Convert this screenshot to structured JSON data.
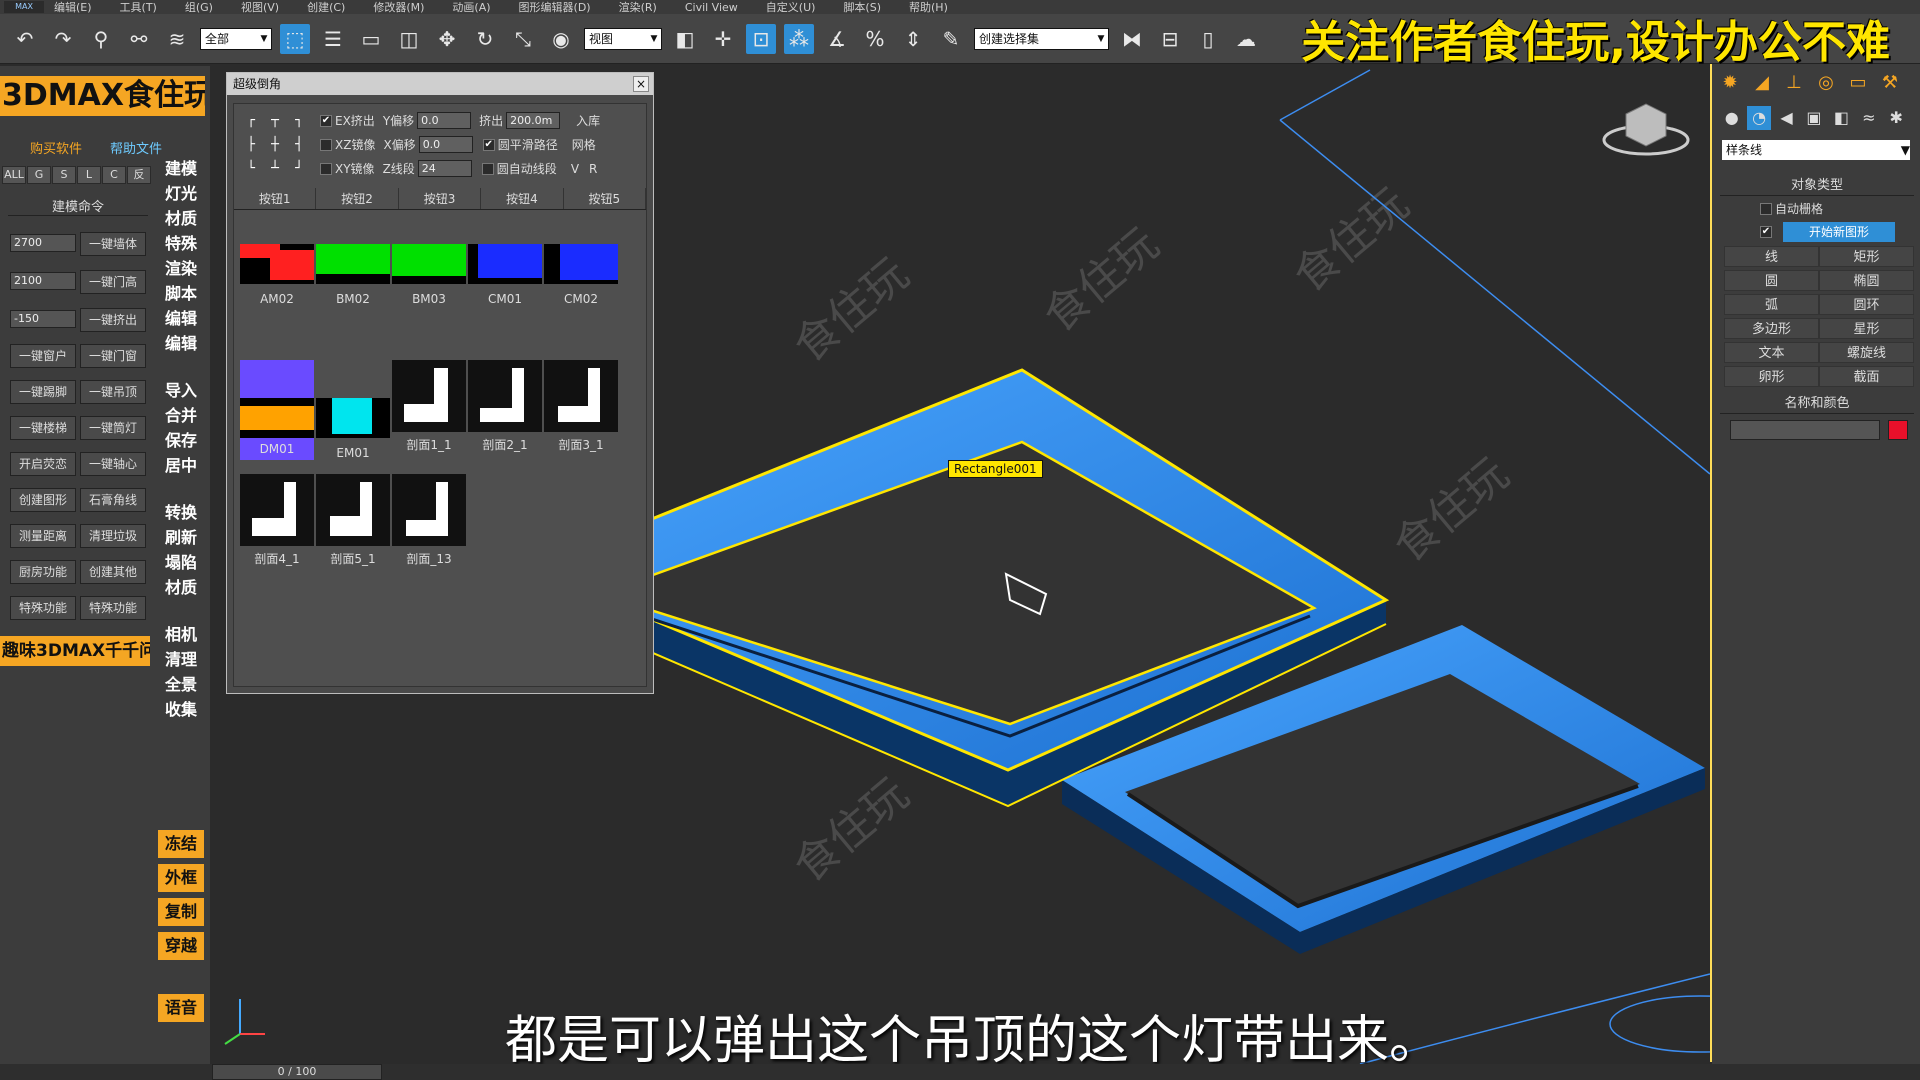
{
  "menu": [
    "编辑(E)",
    "工具(T)",
    "组(G)",
    "视图(V)",
    "创建(C)",
    "修改器(M)",
    "动画(A)",
    "图形编辑器(D)",
    "渲染(R)",
    "Civil View",
    "自定义(U)",
    "脚本(S)",
    "帮助(H)"
  ],
  "app_logo": "MAX",
  "toolbar": {
    "selection_filter": "全部",
    "ref_coord": "视图",
    "named_selection": "创建选择集"
  },
  "banner": "关注作者食住玩,设计办公不难",
  "plugin": {
    "title": "3DMAX食住玩",
    "buy_link": "购买软件",
    "help_link": "帮助文件",
    "filters": [
      "ALL",
      "G",
      "S",
      "L",
      "C",
      "反"
    ],
    "commands_header": "建模命令",
    "fields": [
      "2700",
      "2100",
      "-150"
    ],
    "buttons": [
      "一键墙体",
      "一键门高",
      "一键挤出",
      "一键窗户",
      "一键门窗",
      "一键踢脚",
      "一键吊顶",
      "一键楼梯",
      "一键筒灯",
      "开启荧恋",
      "一键轴心",
      "创建图形",
      "石膏角线",
      "测量距离",
      "清理垃圾",
      "厨房功能",
      "创建其他",
      "特殊功能",
      "特殊功能"
    ],
    "qa_strip": "趣味3DMAX千千问",
    "right_col": [
      "建模",
      "灯光",
      "材质",
      "特殊",
      "渲染",
      "脚本",
      "编辑",
      "编辑",
      "导入",
      "合并",
      "保存",
      "居中",
      "转换",
      "刷新",
      "塌陷",
      "材质",
      "相机",
      "清理",
      "全景",
      "收集"
    ],
    "yellow_buttons": [
      "冻结",
      "外框",
      "复制",
      "穿越",
      "语音"
    ]
  },
  "dialog": {
    "title": "超级倒角",
    "close": "×",
    "align_icons": [
      "┌",
      "┬",
      "┐",
      "├",
      "┼",
      "┤",
      "└",
      "┴",
      "┘"
    ],
    "opt1": {
      "chk1": "EX挤出",
      "y_offset_label": "Y偏移",
      "y_offset": "0.0",
      "extrude_label": "挤出",
      "extrude": "200.0m",
      "btn": "入库"
    },
    "opt2": {
      "chk1": "XZ镜像",
      "x_offset_label": "X偏移",
      "x_offset": "0.0",
      "chk2": "圆平滑路径",
      "btn": "网格"
    },
    "opt3": {
      "chk1": "XY镜像",
      "z_seg_label": "Z线段",
      "z_seg": "24",
      "chk2": "圆自动线段",
      "btn1": "V",
      "btn2": "R"
    },
    "tabs": [
      "按钮1",
      "按钮2",
      "按钮3",
      "按钮4",
      "按钮5"
    ],
    "thumbs": [
      "AM02",
      "BM02",
      "BM03",
      "CM01",
      "CM02",
      "DM01",
      "EM01",
      "剖面1_1",
      "剖面2_1",
      "剖面3_1",
      "剖面4_1",
      "剖面5_1",
      "剖面_13"
    ],
    "colors": {
      "red": "#ff2020",
      "green": "#00e000",
      "blue": "#1a2cff",
      "orange": "#ffa200",
      "cyan": "#00e5ee",
      "purple": "#6a4bff"
    }
  },
  "viewport": {
    "label": "[",
    "object_tag": "Rectangle001",
    "subtitle": "都是可以弹出这个吊顶的这个灯带出来。",
    "watermark": "食住玩",
    "colors": {
      "frame": "#2b8de8",
      "frame_dark": "#0c3f7a",
      "selection": "#ffe600"
    }
  },
  "command_panel": {
    "dropdown": "样条线",
    "object_type_header": "对象类型",
    "auto_grid": "自动栅格",
    "start_new_shape": "开始新图形",
    "shapes": [
      "线",
      "矩形",
      "圆",
      "椭圆",
      "弧",
      "圆环",
      "多边形",
      "星形",
      "文本",
      "螺旋线",
      "卵形",
      "截面"
    ],
    "name_color_header": "名称和颜色",
    "color_swatch": "#e8102a"
  },
  "timeslider": "0 / 100"
}
